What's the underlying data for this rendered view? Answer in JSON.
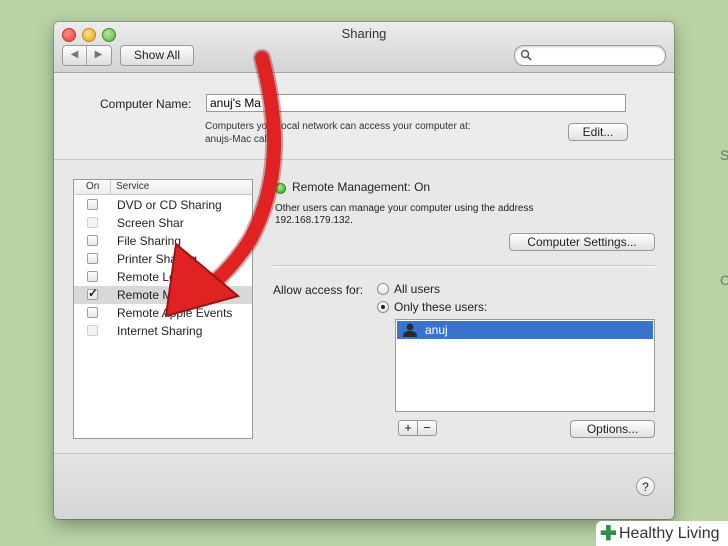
{
  "background": {
    "right_fragments": [
      "S",
      "C"
    ]
  },
  "window": {
    "title": "Sharing",
    "nav_back": "◀",
    "nav_forward": "▶",
    "show_all": "Show All",
    "search_placeholder": ""
  },
  "computer_name": {
    "label": "Computer Name:",
    "value": "anuj's Ma",
    "desc_line1": "Computers      your local network can access your computer at:",
    "desc_line2": "anujs-Mac      cal",
    "edit_button": "Edit..."
  },
  "services": {
    "header_on": "On",
    "header_service": "Service",
    "items": [
      {
        "label": "DVD or CD Sharing",
        "checked": false
      },
      {
        "label": "Screen Shar",
        "checked": false
      },
      {
        "label": "File Sharing",
        "checked": false
      },
      {
        "label": "Printer Sharing",
        "checked": false
      },
      {
        "label": "Remote Login",
        "checked": false
      },
      {
        "label": "Remote Management",
        "checked": true
      },
      {
        "label": "Remote Apple Events",
        "checked": false
      },
      {
        "label": "Internet Sharing",
        "checked": false
      }
    ]
  },
  "detail": {
    "status": "Remote Management: On",
    "status_color": "#2fa620",
    "desc_line1": "Other users can manage your computer using the address",
    "desc_line2": "192.168.179.132.",
    "computer_settings_button": "Computer Settings...",
    "allow_access_label": "Allow access for:",
    "radio_all_users": "All users",
    "radio_only_users": "Only these users:",
    "selected_radio": "only",
    "users": [
      "anuj"
    ],
    "add_button": "+",
    "remove_button": "−",
    "options_button": "Options..."
  },
  "help_button": "?",
  "arrow_color": "#e02222",
  "watermark": {
    "plus": "✚",
    "text": "Healthy Living"
  }
}
